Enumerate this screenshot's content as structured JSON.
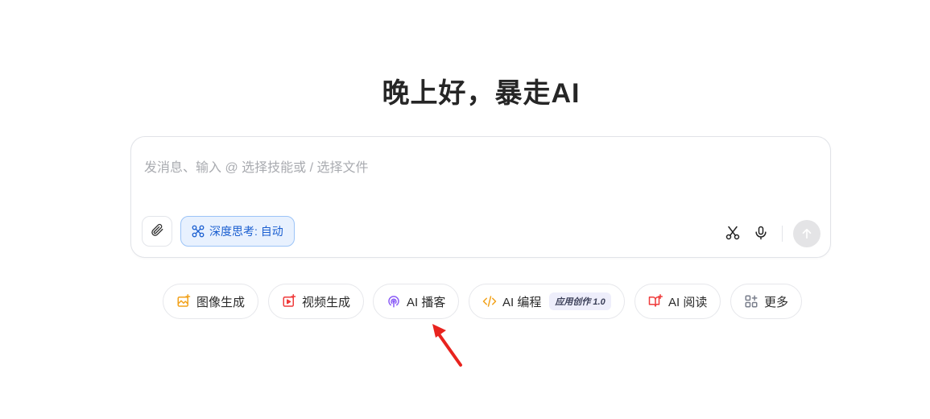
{
  "greeting": "晚上好，暴走AI",
  "composer": {
    "placeholder": "发消息、输入 @ 选择技能或 / 选择文件",
    "deep_think_label": "深度思考: 自动"
  },
  "chips": [
    {
      "label": "图像生成",
      "icon": "image-generate-icon",
      "color": "#f2a21b"
    },
    {
      "label": "视频生成",
      "icon": "video-generate-icon",
      "color": "#ef3b3b"
    },
    {
      "label": "AI 播客",
      "icon": "podcast-icon",
      "color": "#8b5cf6"
    },
    {
      "label": "AI 编程",
      "icon": "code-icon",
      "color": "#f2a21b",
      "badge": "应用创作 1.0"
    },
    {
      "label": "AI 阅读",
      "icon": "reading-icon",
      "color": "#ef3b3b"
    },
    {
      "label": "更多",
      "icon": "grid-more-icon",
      "color": "#7a7f8c"
    }
  ],
  "colors": {
    "accent_blue": "#1b5fd0",
    "annotation_arrow": "#e8231e"
  }
}
